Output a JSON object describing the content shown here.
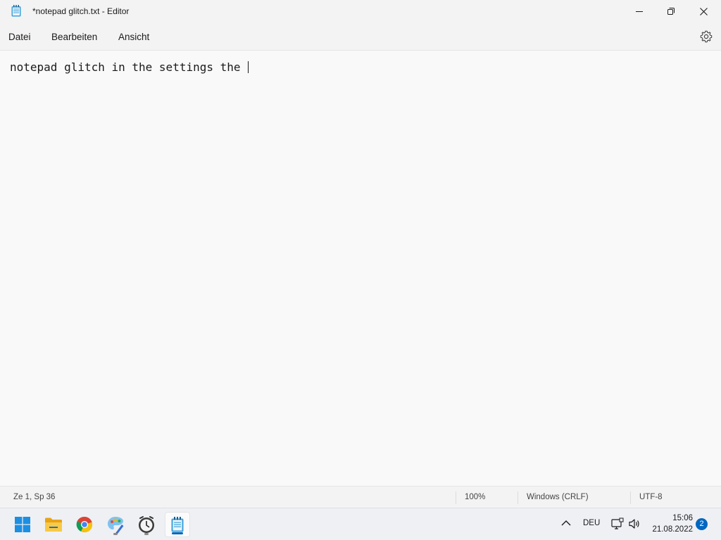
{
  "window": {
    "title": "*notepad glitch.txt - Editor",
    "app_icon": "notepad-icon",
    "buttons": [
      "minimize-icon",
      "maximize-icon",
      "close-icon"
    ]
  },
  "menu": {
    "datei": "Datei",
    "bearbeiten": "Bearbeiten",
    "ansicht": "Ansicht",
    "settings_icon": "gear-icon"
  },
  "editor": {
    "content": "notepad glitch in the settings the "
  },
  "status": {
    "position": "Ze 1, Sp 36",
    "zoom": "100%",
    "line_ending": "Windows (CRLF)",
    "encoding": "UTF-8"
  },
  "taskbar": {
    "apps": [
      "windows-start-icon",
      "file-explorer-icon",
      "chrome-icon",
      "paint-icon",
      "clock-app-icon",
      "notepad-icon"
    ],
    "tray": {
      "language": "DEU",
      "time": "15:06",
      "date": "21.08.2022",
      "notifications": "2"
    }
  },
  "colors": {
    "accent": "#0067c0",
    "background": "#f9f9f9",
    "chrome": "#f3f3f3"
  }
}
